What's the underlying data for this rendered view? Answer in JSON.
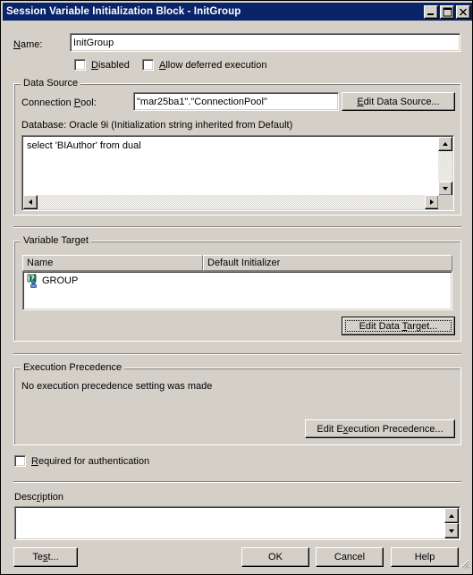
{
  "window": {
    "title": "Session Variable Initialization Block - InitGroup",
    "controls": {
      "minimize": "minimize-icon",
      "maximize": "maximize-icon",
      "close": "close-icon"
    },
    "titlebar_color": "#0a246a",
    "face_color": "#d4d0c8"
  },
  "name_row": {
    "label": "Name:",
    "label_accel": "N",
    "value": "InitGroup",
    "placeholder": ""
  },
  "options": {
    "disabled": {
      "label": "Disabled",
      "accel": "D",
      "checked": false
    },
    "allow_deferred": {
      "label": "Allow deferred execution",
      "accel": "A",
      "checked": false
    }
  },
  "data_source": {
    "group_title": "Data Source",
    "connection_pool_label": "Connection Pool:",
    "connection_pool_accel": "P",
    "connection_pool_value": "\"mar25ba1\".\"ConnectionPool\"",
    "edit_button": "Edit Data Source...",
    "edit_button_accel": "E",
    "database_line": "Database: Oracle 9i (Initialization string inherited from Default)",
    "sql_text": "select 'BIAuthor' from dual",
    "scroll_up": "scroll-up-arrow",
    "scroll_down": "scroll-down-arrow",
    "scroll_left": "scroll-left-arrow",
    "scroll_right": "scroll-right-arrow"
  },
  "variable_target": {
    "group_title": "Variable Target",
    "columns": [
      "Name",
      "Default Initializer"
    ],
    "rows": [
      {
        "name": "GROUP",
        "default_initializer": "",
        "icon": "session-variable-icon"
      }
    ],
    "edit_button": "Edit Data Target...",
    "edit_button_accel": "T",
    "edit_button_focused": true
  },
  "execution_precedence": {
    "group_title": "Execution Precedence",
    "status_text": "No execution precedence setting was made",
    "edit_button": "Edit Execution Precedence...",
    "edit_button_accel": "x"
  },
  "required_for_auth": {
    "label": "Required for authentication",
    "accel": "R",
    "checked": false
  },
  "description": {
    "label": "Description",
    "accel": "r",
    "value": "",
    "scroll_up": "scroll-up-arrow",
    "scroll_down": "scroll-down-arrow"
  },
  "footer": {
    "test": "Test...",
    "test_accel": "s",
    "ok": "OK",
    "cancel": "Cancel",
    "help": "Help",
    "resize_grip": "resize-grip-icon"
  }
}
